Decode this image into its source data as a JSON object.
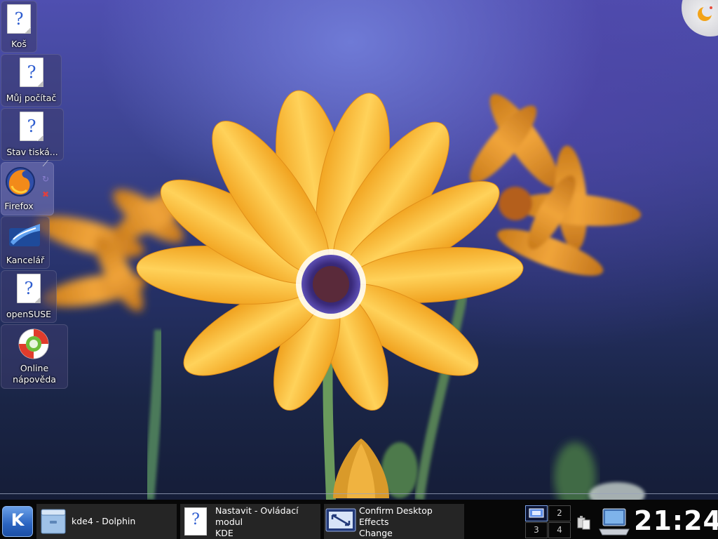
{
  "desktop": {
    "icons": [
      {
        "label": "Koš"
      },
      {
        "label": "Můj počítač"
      },
      {
        "label": "Stav tiská..."
      },
      {
        "label": "Firefox"
      },
      {
        "label": "Kancelář"
      },
      {
        "label": "openSUSE"
      },
      {
        "label_line1": "Online",
        "label_line2": "nápověda"
      }
    ],
    "doc_glyph": "?"
  },
  "taskbar": {
    "kmenu_glyph": "K",
    "tasks": [
      {
        "lines": [
          "kde4 - Dolphin"
        ],
        "icon": "folder-icon"
      },
      {
        "lines": [
          "Nastavit - Ovládací",
          "modul",
          "KDE"
        ],
        "icon": "unknown-document-icon"
      },
      {
        "lines": [
          "Confirm Desktop",
          "Effects",
          "Change"
        ],
        "icon": "display-settings-icon"
      }
    ],
    "pager": [
      "1",
      "2",
      "3",
      "4"
    ],
    "clock": "21:24"
  },
  "colors": {
    "taskbar_bg": "#070707",
    "task_bg": "#252525",
    "accent": "#2a63c0",
    "flower": "#f7b52c"
  }
}
